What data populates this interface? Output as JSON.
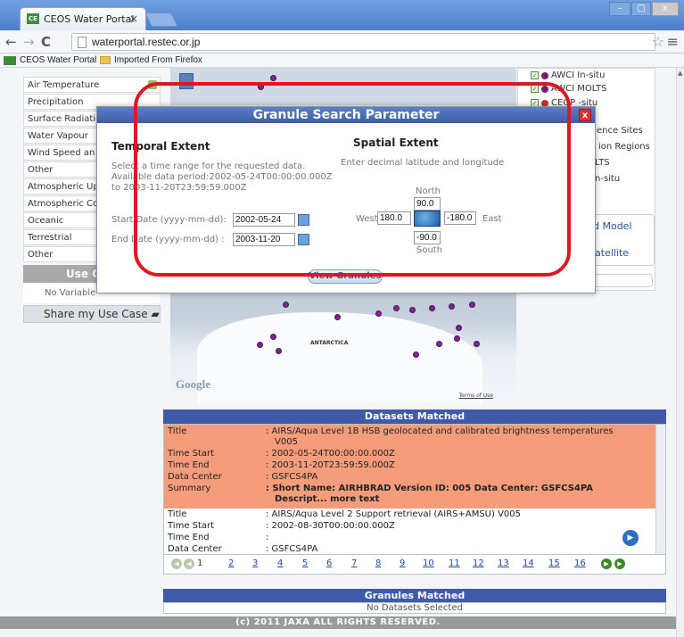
{
  "browser": {
    "tab_title": "CEOS Water Portal",
    "tab_close": "×",
    "url": "waterportal.restec.or.jp",
    "bookmarks": [
      "CEOS Water Portal",
      "Imported From Firefox"
    ],
    "win_buttons": [
      "–",
      "□",
      "x"
    ]
  },
  "sidebar": {
    "items": [
      "Air Temperature",
      "Precipitation",
      "Surface Radiatic",
      "Water Vapour",
      "Wind Speed an",
      "Other",
      "Atmospheric Upp",
      "Atmospheric Cor",
      "Oceanic",
      "Terrestrial",
      "Other"
    ],
    "use_case_header": "Use C",
    "no_variable": "No Variable",
    "share_button": "Share my Use Case"
  },
  "right_panel": {
    "items": [
      "AWCI In-situ",
      "AWCI MOLTS",
      "CEOP -situ",
      "ence Sites",
      "ion Regions",
      "LTS",
      "n-situ"
    ],
    "links": [
      "d Model",
      "atellite"
    ]
  },
  "map": {
    "label": "ANTARCTICA",
    "google": "Google",
    "terms": "Terms of Use"
  },
  "modal": {
    "title": "Granule Search Parameter",
    "close": "x",
    "temporal": {
      "heading": "Temporal Extent",
      "desc1": "Select a time range for the requested data.",
      "desc2": "Available data period:2002-05-24T00:00:00.000Z",
      "desc3": "to 2003-11-20T23:59:59.000Z",
      "start_label": "Start Date (yyyy-mm-dd):",
      "start_value": "2002-05-24",
      "end_label": "End Date (yyyy-mm-dd) :",
      "end_value": "2003-11-20"
    },
    "spatial": {
      "heading": "Spatial Extent",
      "desc": "Enter decimal latitude and longitude",
      "north_label": "North",
      "north_value": "90.0",
      "west_label": "West",
      "west_value": "180.0",
      "east_value": "-180.0",
      "east_label": "East",
      "south_value": "-90.0",
      "south_label": "South"
    },
    "view_button": "View Granules"
  },
  "datasets": {
    "header": "Datasets Matched",
    "rows": [
      {
        "k": "Title",
        "v": ": AIRS/Aqua Level 1B HSB geolocated and calibrated brightness temperatures"
      },
      {
        "k": "",
        "v": "V005"
      },
      {
        "k": "Time Start",
        "v": ": 2002-05-24T00:00:00.000Z"
      },
      {
        "k": "Time End",
        "v": ": 2003-11-20T23:59:59.000Z"
      },
      {
        "k": "Data Center",
        "v": ": GSFCS4PA"
      },
      {
        "k": "Summary",
        "v": ": Short Name: AIRHBRAD Version ID: 005 Data Center: GSFCS4PA"
      },
      {
        "k": "",
        "v": "Descript... more text"
      },
      {
        "k": "Title",
        "v": ": AIRS/Aqua Level 2 Support retrieval (AIRS+AMSU) V005"
      },
      {
        "k": "Time Start",
        "v": ": 2002-08-30T00:00:00.000Z"
      },
      {
        "k": "Time End",
        "v": ":"
      },
      {
        "k": "Data Center",
        "v": ": GSFCS4PA"
      }
    ],
    "pages": [
      "1",
      "2",
      "3",
      "4",
      "5",
      "6",
      "7",
      "8",
      "9",
      "10",
      "11",
      "12",
      "13",
      "14",
      "15",
      "16"
    ]
  },
  "granules": {
    "header": "Granules Matched",
    "body": "No Datasets Selected"
  },
  "footer": "(c) 2011 JAXA ALL RIGHTS RESERVED.",
  "colors": {
    "highlight": "#e0171f",
    "header_blue": "#3e5aa8",
    "dataset_highlight": "#f59c7a"
  }
}
